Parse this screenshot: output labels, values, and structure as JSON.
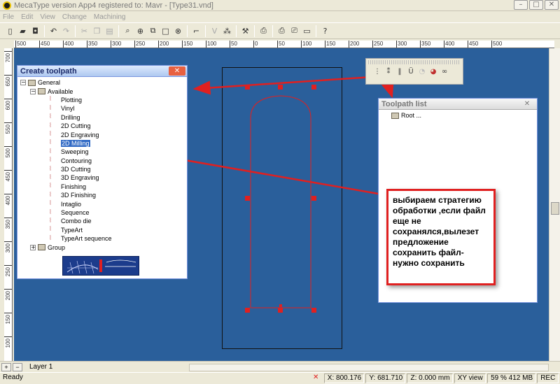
{
  "window": {
    "title": "MecaType  version  App4 registered to: Mavr - [Type31.vnd]"
  },
  "menu": [
    "File",
    "Edit",
    "View",
    "Change",
    "Machining"
  ],
  "ruler_h_labels": [
    "500",
    "450",
    "400",
    "350",
    "300",
    "250",
    "200",
    "150",
    "100",
    "50",
    "0",
    "50",
    "100",
    "150",
    "200",
    "250",
    "300",
    "350",
    "400",
    "450",
    "500"
  ],
  "ruler_v_labels": [
    "700",
    "650",
    "600",
    "550",
    "500",
    "450",
    "400",
    "350",
    "300",
    "250",
    "200",
    "150",
    "100"
  ],
  "create_toolpath": {
    "title": "Create toolpath",
    "tree": {
      "root": "General",
      "available": "Available",
      "tools": [
        "Plotting",
        "Vinyl",
        "Drilling",
        "2D Cutting",
        "2D Engraving",
        "2D Milling",
        "Sweeping",
        "Contouring",
        "3D Cutting",
        "3D Engraving",
        "Finishing",
        "3D Finishing",
        "Intaglio",
        "Sequence",
        "Combo die",
        "TypeArt",
        "TypeArt sequence"
      ],
      "selected": "2D Milling",
      "group": "Group"
    }
  },
  "toolpath_list": {
    "title": "Toolpath list",
    "root": "Root ..."
  },
  "annotation": {
    "text": "выбираем стратегию обработки ,если файл еще не сохранялся,вылезет предложение сохранить файл-нужно сохранить"
  },
  "bottom": {
    "layer": "Layer 1"
  },
  "status": {
    "ready": "Ready",
    "x": "X: 800.176",
    "y": "Y: 681.710",
    "z": "Z: 0.000 mm",
    "view": "XY view",
    "zoom": "59 % 412 MB",
    "mode": "REC"
  },
  "colors": {
    "canvas": "#2a5f9b",
    "accent_red": "#e02020",
    "selection": "#316ac5"
  }
}
